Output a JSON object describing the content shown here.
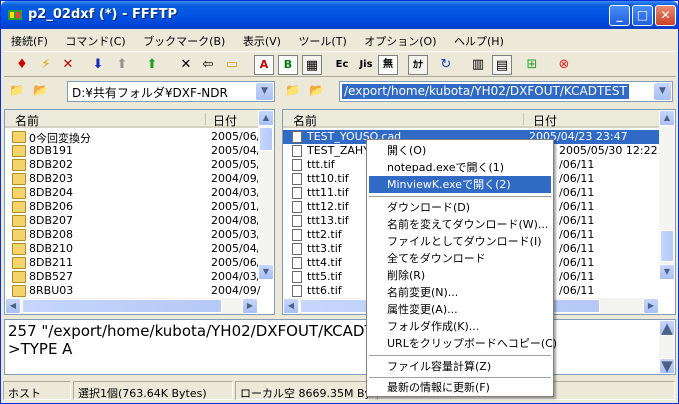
{
  "window": {
    "title": "p2_02dxf (*) - FFFTP"
  },
  "menu": [
    "接続(F)",
    "コマンド(C)",
    "ブックマーク(B)",
    "表示(V)",
    "ツール(T)",
    "オプション(O)",
    "ヘルプ(H)"
  ],
  "toolbar": {
    "ascii": "A",
    "binary": "B",
    "exc": "Ec",
    "jis": "Jis",
    "none": "無",
    "kana": "ｶﾅ"
  },
  "local": {
    "path": "D:¥共有フォルダ¥DXF-NDR",
    "col_name": "名前",
    "col_date": "日付",
    "rows": [
      {
        "name": "0今回変換分",
        "date": "2005/06/"
      },
      {
        "name": "8DB191",
        "date": "2005/04/"
      },
      {
        "name": "8DB202",
        "date": "2005/05/"
      },
      {
        "name": "8DB203",
        "date": "2004/09/"
      },
      {
        "name": "8DB204",
        "date": "2004/03/"
      },
      {
        "name": "8DB206",
        "date": "2005/01/"
      },
      {
        "name": "8DB207",
        "date": "2004/08/"
      },
      {
        "name": "8DB208",
        "date": "2005/03/"
      },
      {
        "name": "8DB210",
        "date": "2005/04/"
      },
      {
        "name": "8DB211",
        "date": "2005/06/"
      },
      {
        "name": "8DB527",
        "date": "2004/03/"
      },
      {
        "name": "8RBU03",
        "date": "2004/09/"
      }
    ]
  },
  "remote": {
    "path": "/export/home/kubota/YH02/DXFOUT/KCADTEST",
    "col_name": "名前",
    "col_date": "日付",
    "rows": [
      {
        "name": "TEST_YOUSO.cad",
        "date": "2005/04/23 23:47",
        "selected": true
      },
      {
        "name": "TEST_ZAHYO",
        "date": "2005/05/30 12:22"
      },
      {
        "name": "ttt.tif",
        "date": "/06/11"
      },
      {
        "name": "ttt10.tif",
        "date": "/06/11"
      },
      {
        "name": "ttt11.tif",
        "date": "/06/11"
      },
      {
        "name": "ttt12.tif",
        "date": "/06/11"
      },
      {
        "name": "ttt13.tif",
        "date": "/06/11"
      },
      {
        "name": "ttt2.tif",
        "date": "/06/11"
      },
      {
        "name": "ttt3.tif",
        "date": "/06/11"
      },
      {
        "name": "ttt4.tif",
        "date": "/06/11"
      },
      {
        "name": "ttt5.tif",
        "date": "/06/11"
      },
      {
        "name": "ttt6.tif",
        "date": "/06/11"
      }
    ]
  },
  "log": {
    "line1": "257 \"/export/home/kubota/YH02/DXFOUT/KCADTEST\"",
    "line2": ">TYPE A"
  },
  "status": {
    "host": "ホスト",
    "selection": "選択1個(763.64K Bytes)",
    "local_free": "ローカル空 8669.35M Bytes"
  },
  "context_menu": {
    "items": [
      "開く(O)",
      "notepad.exeで開く(1)",
      "MinviewK.exeで開く(2)",
      "ダウンロード(D)",
      "名前を変えてダウンロード(W)...",
      "ファイルとしてダウンロード(I)",
      "全てをダウンロード",
      "削除(R)",
      "名前変更(N)...",
      "属性変更(A)...",
      "フォルダ作成(K)...",
      "URLをクリップボードへコピー(C)",
      "ファイル容量計算(Z)",
      "最新の情報に更新(F)"
    ],
    "highlighted": "MinviewK.exeで開く(2)"
  },
  "colors": {
    "title_blue": "#0054e3",
    "selection": "#316ac5",
    "face": "#ece9d8"
  }
}
